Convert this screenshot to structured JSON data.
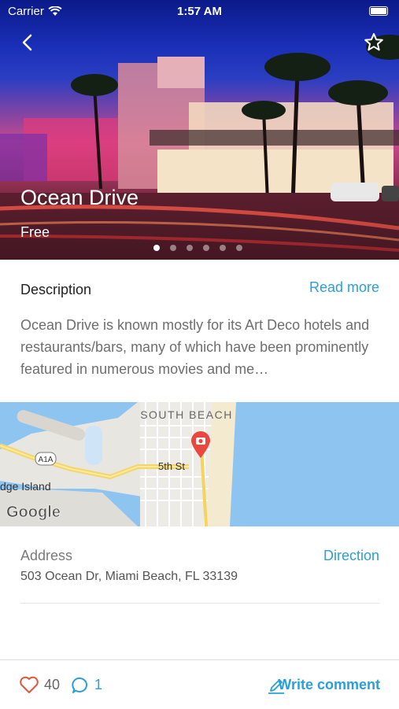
{
  "status_bar": {
    "carrier": "Carrier",
    "time": "1:57 AM"
  },
  "hero": {
    "title": "Ocean Drive",
    "price": "Free",
    "page_count": 6,
    "active_page": 1
  },
  "description": {
    "heading": "Description",
    "read_more": "Read more",
    "text": "Ocean Drive is known mostly for its Art Deco hotels and restaurants/bars, many of which have been prominently featured in numerous movies and me…"
  },
  "map": {
    "labels": {
      "area": "SOUTH BEACH",
      "street": "5th St",
      "road": "A1A",
      "island": "dge Island",
      "brand": "Google"
    },
    "pin_icon": "camera-pin-icon"
  },
  "address": {
    "label": "Address",
    "value": "503 Ocean Dr, Miami Beach, FL 33139",
    "direction": "Direction"
  },
  "bottom_bar": {
    "likes": "40",
    "comments": "1",
    "write_comment": "Write comment"
  },
  "colors": {
    "accent": "#2a9fd8",
    "like": "#e0573a",
    "pin": "#e8483e"
  }
}
